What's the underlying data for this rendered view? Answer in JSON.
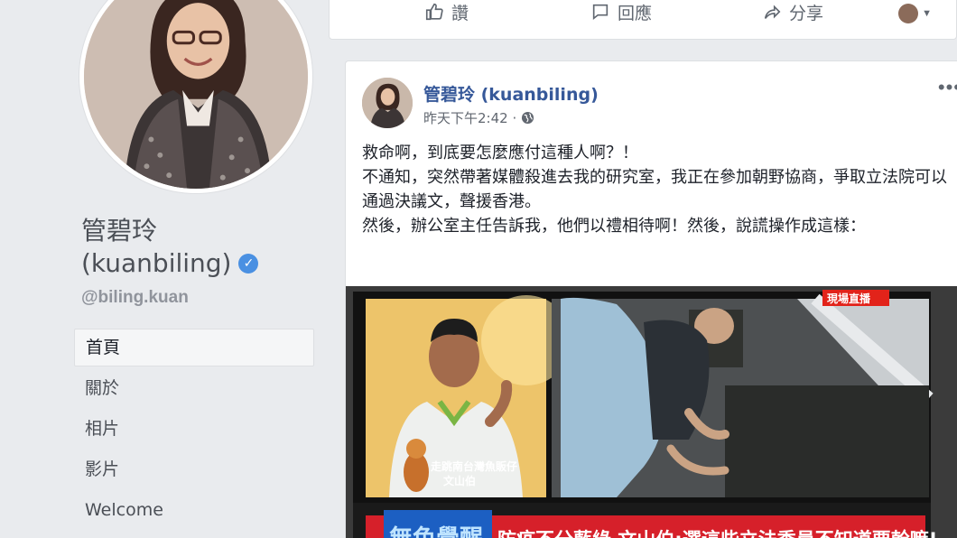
{
  "profile": {
    "name_line1": "管碧玲",
    "name_line2": "(kuanbiling)",
    "username": "@biling.kuan"
  },
  "nav": {
    "items": [
      {
        "label": "首頁",
        "active": true
      },
      {
        "label": "關於",
        "active": false
      },
      {
        "label": "相片",
        "active": false
      },
      {
        "label": "影片",
        "active": false
      },
      {
        "label": "Welcome",
        "active": false
      }
    ]
  },
  "prev_post_actions": {
    "like": "讚",
    "comment": "回應",
    "share": "分享"
  },
  "post": {
    "author": "管碧玲 (kuanbiling)",
    "time": "昨天下午2:42 ·",
    "more": "•••",
    "paragraphs": [
      "救命啊，到底要怎麼應付這種人啊？！",
      "不通知，突然帶著媒體殺進去我的研究室，我正在參加朝野協商，爭取立法院可以通過決議文，聲援香港。",
      "然後，辦公室主任告訴我，他們以禮相待啊！然後，說謊操作成這樣："
    ]
  },
  "tv_screen": {
    "live_badge": "現場直播",
    "caption_left": "走跳南台灣魚販仔",
    "caption_name": "文山伯",
    "ticker_logo": "無色覺醒",
    "ticker_text": "防疫不分藍綠 文山伯:選這些立法委員不知道要幹嘛!"
  },
  "colors": {
    "link": "#365899",
    "verified": "#4a90e2",
    "ticker_red": "#d6202a",
    "ticker_blue": "#1c5fc2",
    "live_red": "#e2231a"
  }
}
